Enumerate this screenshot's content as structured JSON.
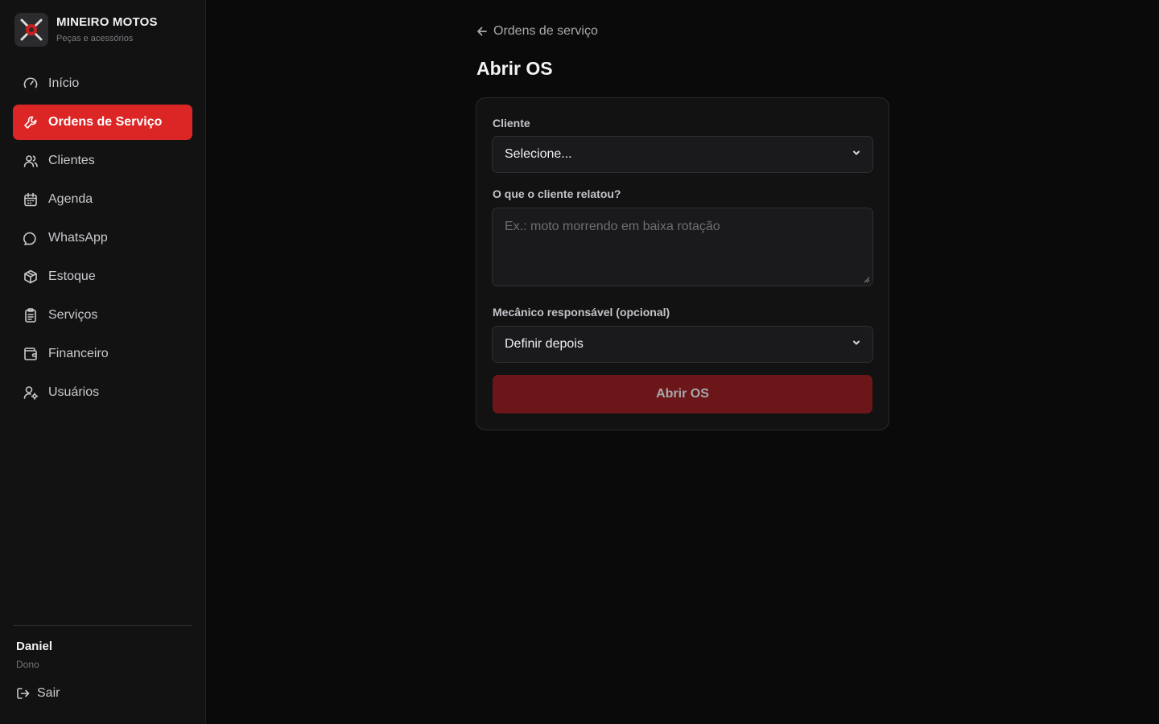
{
  "brand": {
    "name": "MINEIRO MOTOS",
    "subtitle": "Peças e acessórios",
    "logo_text": "MINEIRO"
  },
  "sidebar": {
    "items": [
      {
        "label": "Início",
        "icon": "gauge-icon",
        "active": false
      },
      {
        "label": "Ordens de Serviço",
        "icon": "wrench-icon",
        "active": true
      },
      {
        "label": "Clientes",
        "icon": "users-icon",
        "active": false
      },
      {
        "label": "Agenda",
        "icon": "calendar-icon",
        "active": false
      },
      {
        "label": "WhatsApp",
        "icon": "chat-bubble-icon",
        "active": false
      },
      {
        "label": "Estoque",
        "icon": "package-icon",
        "active": false
      },
      {
        "label": "Serviços",
        "icon": "clipboard-icon",
        "active": false
      },
      {
        "label": "Financeiro",
        "icon": "wallet-icon",
        "active": false
      },
      {
        "label": "Usuários",
        "icon": "user-cog-icon",
        "active": false
      }
    ],
    "user": {
      "name": "Daniel",
      "role": "Dono"
    },
    "logout_label": "Sair"
  },
  "main": {
    "back_label": "Ordens de serviço",
    "title": "Abrir OS",
    "form": {
      "client_label": "Cliente",
      "client_value": "Selecione...",
      "report_label": "O que o cliente relatou?",
      "report_placeholder": "Ex.: moto morrendo em baixa rotação",
      "mechanic_label": "Mecânico responsável (opcional)",
      "mechanic_value": "Definir depois",
      "submit_label": "Abrir OS"
    }
  },
  "colors": {
    "accent": "#dc2626",
    "submit_disabled": "#6b171a",
    "background": "#0a0a0b",
    "sidebar": "#121213"
  }
}
